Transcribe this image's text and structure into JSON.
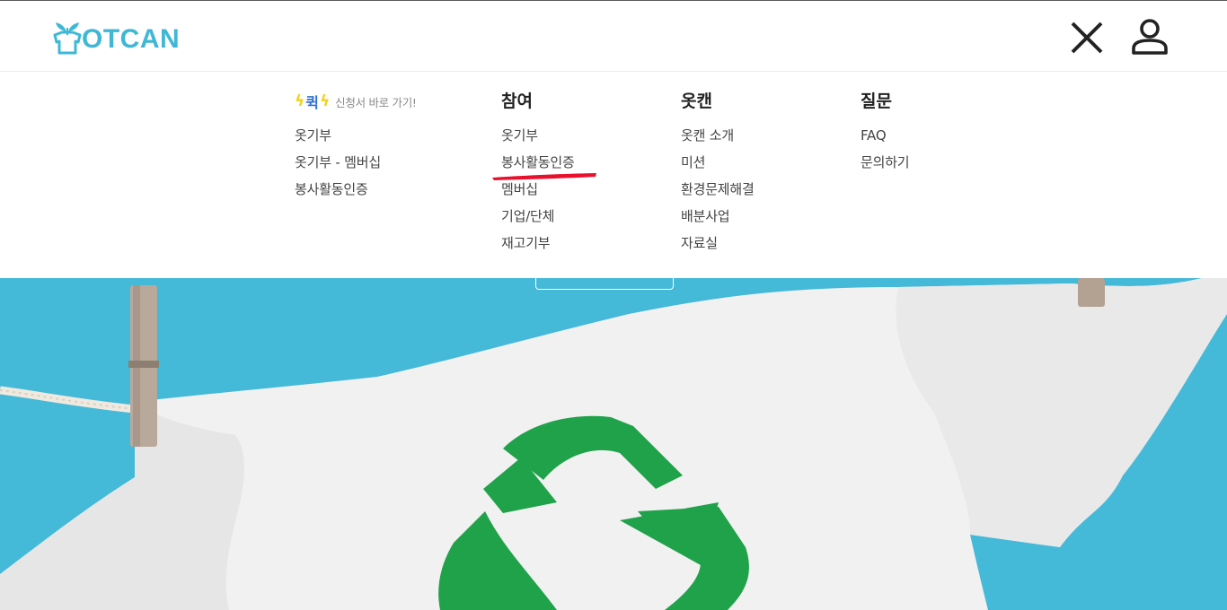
{
  "brand": {
    "logo_text": "OTCAN",
    "color": "#3fb8d6"
  },
  "header": {
    "close_icon": "close-icon",
    "user_icon": "user-icon"
  },
  "quick": {
    "badge": "퀵",
    "subtitle": "신청서 바로 가기!",
    "items": [
      "옷기부",
      "옷기부 - 멤버십",
      "봉사활동인증"
    ]
  },
  "join": {
    "title": "참여",
    "items": [
      "옷기부",
      "봉사활동인증",
      "멤버십",
      "기업/단체",
      "재고기부"
    ]
  },
  "otcan": {
    "title": "옷캔",
    "items": [
      "옷캔 소개",
      "미션",
      "환경문제해결",
      "배분사업",
      "자료실"
    ]
  },
  "question": {
    "title": "질문",
    "items": [
      "FAQ",
      "문의하기"
    ]
  },
  "colors": {
    "hero_bg": "#45b9d8",
    "accent_red": "#e8112d",
    "recycle_green": "#1fa24a"
  }
}
